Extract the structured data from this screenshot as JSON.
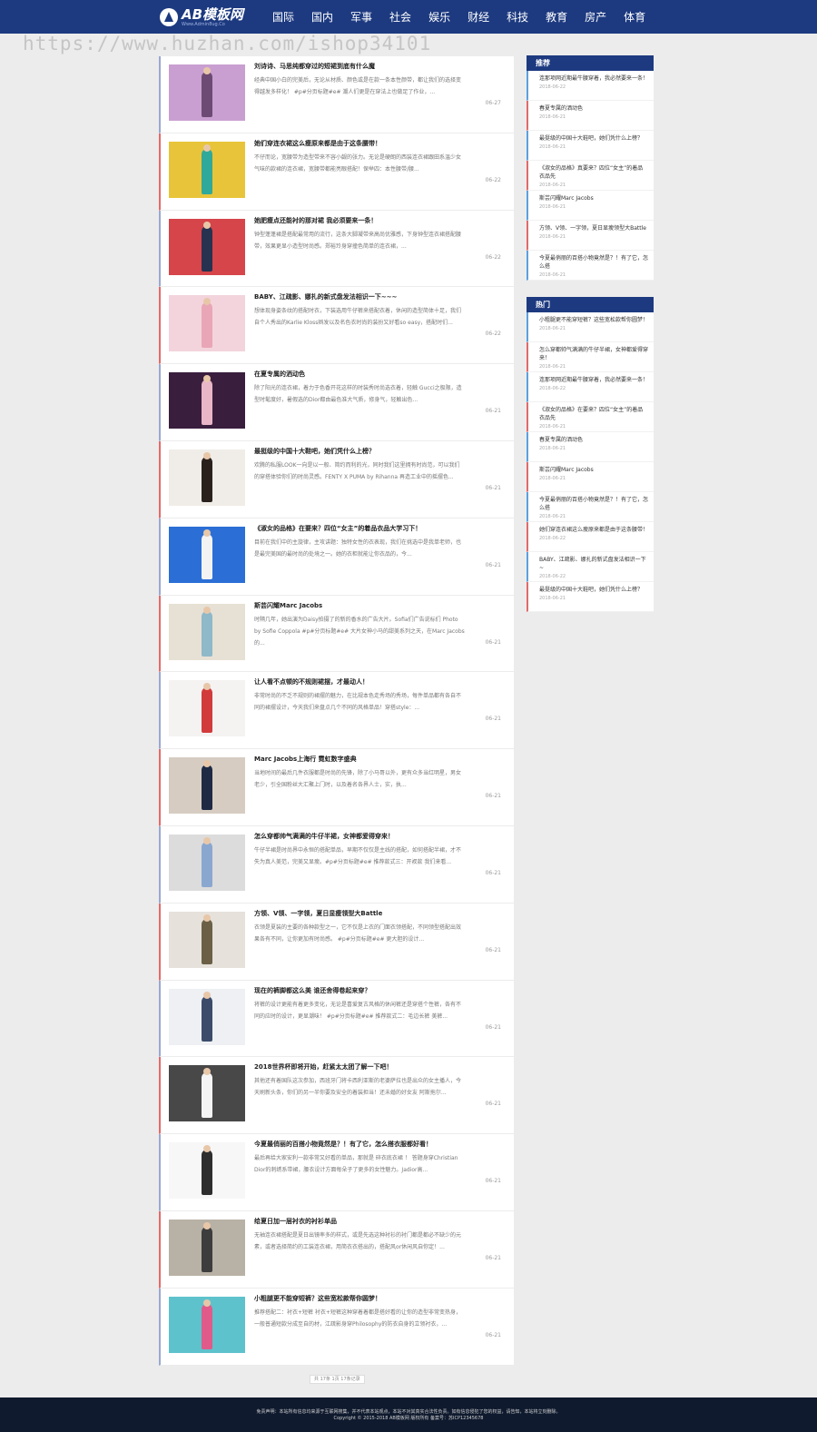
{
  "header": {
    "logo_main": "AB模板网",
    "logo_sub": "Www.Admin8ug.Co",
    "nav": [
      "国际",
      "国内",
      "军事",
      "社会",
      "娱乐",
      "财经",
      "科技",
      "教育",
      "房产",
      "体育"
    ]
  },
  "watermark": "https://www.huzhan.com/ishop34101",
  "articles": [
    {
      "title": "刘诗诗、马思纯都穿过的短裙到底有什么魔",
      "desc": "经典中国小白的完美后，无论从材质、颜色或是在款一条本性颜带，都让我们的选择变得越发多样化！ #p#分页标题#e# 潮人们更是在穿法上也做足了作业，...",
      "date": "06-27"
    },
    {
      "title": "她们穿连衣裙这么瘦原来都是由于这条腰带！",
      "desc": "不仔而论，宽腰带为造型带来不容小觑的张力。无论是硬朗的西装连衣裙跟田系温少女气味的款裙的连衣裙，宽腰带都能亮眼搭配！保举四：本性腰带/腰...",
      "date": "06-22"
    },
    {
      "title": "她肥瘦点还能衬的那对裙 我必须要来一条！",
      "desc": "钟型蓬蓬裙是搭配最常用的流行，这条大脚凝带来高尚优雅感，下身钟型连衣裙搭配腰带，效果更显小造型时尚感。郑裕玲身穿撞色简单的连衣裙，...",
      "date": "06-22"
    },
    {
      "title": "BABY、江疏影、娜扎的新式盘发法相识一下~~~",
      "desc": "想体现身姿条纹的搭配时衣，下装选用牛仔裤来搭配衣着，休闲的造型简体十足，我们自个人秀出的Karlie Kloss辫发以及名色衣时尚的装扮又好看so easy，搭配时们...",
      "date": "06-22"
    },
    {
      "title": "在夏专属的洒动色",
      "desc": "除了阳光的连衣裙，着力于色香开花这样的时装秀时尚选衣着，轻触 Gucci之极限，造型时髦度好，暑假选的Dior都由最色准大气质，修身气，轻触出色...",
      "date": "06-21"
    },
    {
      "title": "最挺级的中国十大鞋吧，她们凭什么上榜？",
      "desc": "欢腾的私服LOOK一向是以一般、简约而利的光，同时我们这里拥有时尚范，可以我们的穿搭体验你们的时尚灵感。FENTY X PUMA by Rihanna 再造工业中的摇摆色...",
      "date": "06-21"
    },
    {
      "title": "《淑女的品格》在要来？四位“女主”的着品衣品大学习下！",
      "desc": "目前在我们中的主旋律，主攻讲题：独特女性的衣表现，我们在挑选中是我单老师，也是最完美国的最时尚的处境之一。她的衣柜就能让你衣品的，今...",
      "date": "06-21"
    },
    {
      "title": "斯芸闪耀Marc Jacobs",
      "desc": "时隔几年，她出演为Daisy拍摄了的新的香水的广告大片。Sofia们广告说标们 Photo by Sofie Coppola #p#分页标题#e# 大片女神小马的甜美系列之天，在Marc Jacobs的...",
      "date": "06-21"
    },
    {
      "title": "让人看不点顿的不规则裙摆，才最动人！",
      "desc": "非常时尚的不乏不规则的裙摆的魅力，在比规本色走秀场的秀场，每件单品都有各自不同的裙摆设计，今天我们来盘点几个不同的风格单品！穿搭style：...",
      "date": "06-21"
    },
    {
      "title": "Marc Jacobs上海行 霓虹数字盛典",
      "desc": "当地时间的最后几件衣服都是时尚的先锋，除了小马哥以外，更有众多当红明星，男女老少，引全国粉丝大汇聚上门时，以及着名各界人士，实，执...",
      "date": "06-21"
    },
    {
      "title": "怎么穿都帅气满满的牛仔半裙，女神都爱得穿来！",
      "desc": "牛仔半裙是时尚界中永恒的搭配单品，早期不仅仅是主线的搭配，如何搭配半裙，才不失为真人美范，完美又显瘦。#p#分页标题#e# 推荐款式三：开衩款 我们来看...",
      "date": "06-21"
    },
    {
      "title": "方领、V领、一字领，夏日显瘦领型大Battle",
      "desc": "衣领是夏装的主要的各种款型之一，它不仅是上衣的门面衣领搭配，不同领型搭配出效果各有不同，让你更加有时尚感。 #p#分页标题#e# 更大胆的设计...",
      "date": "06-21"
    },
    {
      "title": "现在的裤脚都这么美 谁还舍得卷起来穿？",
      "desc": "将裤的设计更能有着更多变化，无论是喜爱复古风格的休闲裤还是穿搭个性裤，各有不同的应时的设计，更显潮味！ #p#分页标题#e# 推荐款式二：毛边长裤 美裤...",
      "date": "06-21"
    },
    {
      "title": "2018世界杯即将开始，赶紧太太团了解一下吧！",
      "desc": "其他还有着国队这次参加，西班牙门将卡西利亚斯的老婆萨拉也是出众的女主播人，今天刷新头条，你们的另一半你要及安全的着装担当！还未婚的好女友 阿斯拖尔...",
      "date": "06-21"
    },
    {
      "title": "今夏最俏丽的百搭小物竟然是？！有了它，怎么搭衣服都好看！",
      "desc": "最后再给大家安利一款非常又好看的单品，那就是 碎衣底衣裙 ！ 答题身穿Christian Dior的刺绣系带裙，腰衣设计方面每朵子了更多的女性魅力。Jadior高...",
      "date": "06-21"
    },
    {
      "title": "给夏日加一层衬衣的衬衫单品",
      "desc": "无袖连衣裙搭配是夏日出镜率多的样式，或是先选这种衬衫的衬门都是都必不缺少的元素，或者选择简约的工装连衣裙，用简衣衣搭出的，搭配风or休闲风自你定！...",
      "date": "06-21"
    },
    {
      "title": "小粗腿更不能穿短裤？这些宽松款帮你圆梦！",
      "desc": "推荐搭配二：衬衣+短裤 衬衣+短裤这种穿着着都是搭好看的让你的造型非常变热身，一般普通短款分成至自的材，江疏影身穿Philosophy的防衣自身的立领衬衣，...",
      "date": "06-21"
    }
  ],
  "pager": "共 17条 1页 17条记录",
  "sidebar": {
    "recommend_title": "推荐",
    "recommend": [
      {
        "title": "连那项网近期最牛腰穿着，我必然要来一条！",
        "date": "2018-06-22"
      },
      {
        "title": "春夏专属的洒动色",
        "date": "2018-06-21"
      },
      {
        "title": "最挺级的中国十大鞋吧，她们凭什么上榜？",
        "date": "2018-06-21"
      },
      {
        "title": "《淑女的品格》真要来？四位“女主”的着品衣品先",
        "date": "2018-06-21"
      },
      {
        "title": "斯芸闪耀Marc Jacobs",
        "date": "2018-06-21"
      },
      {
        "title": "方领、V领、一字领，夏日显瘦领型大Battle",
        "date": "2018-06-21"
      },
      {
        "title": "今夏最俏丽的百搭小物竟然是？！有了它，怎么搭",
        "date": "2018-06-21"
      }
    ],
    "hot_title": "热门",
    "hot": [
      {
        "title": "小粗腿更不能穿短裤？这些宽松款帮你圆梦！",
        "date": "2018-06-21"
      },
      {
        "title": "怎么穿都帅气满满的牛仔半裙，女神都爱得穿来！",
        "date": "2018-06-21"
      },
      {
        "title": "连那项网近期最牛腰穿着，我必然要来一条！",
        "date": "2018-06-22"
      },
      {
        "title": "《淑女的品格》在要来？四位“女主”的着品衣品先",
        "date": "2018-06-21"
      },
      {
        "title": "春夏专属的洒动色",
        "date": "2018-06-21"
      },
      {
        "title": "斯芸闪耀Marc Jacobs",
        "date": "2018-06-21"
      },
      {
        "title": "今夏最俏丽的百搭小物竟然是？！有了它，怎么搭",
        "date": "2018-06-21"
      },
      {
        "title": "她们穿连衣裙这么瘦原来都是由于这条腰带！",
        "date": "2018-06-22"
      },
      {
        "title": "BABY、江疏影、娜扎的新式盘发法相识一下~",
        "date": "2018-06-22"
      },
      {
        "title": "最挺级的中国十大鞋吧，她们凭什么上榜？",
        "date": "2018-06-21"
      }
    ]
  },
  "footer": {
    "line1": "免责声明：本站所有信息均来源于互联网搜集，并不代表本站观点，本站不对其真实合法性负责。如有信息侵犯了您的权益，请告知，本站将立刻删除。",
    "line2": "Copyright © 2015-2018 AB模板网 版权所有 备案号：苏ICP12345678"
  },
  "colors": {
    "primary": "#1d3a80",
    "accent_red": "#e26a6a",
    "accent_blue": "#5aa0e0"
  }
}
